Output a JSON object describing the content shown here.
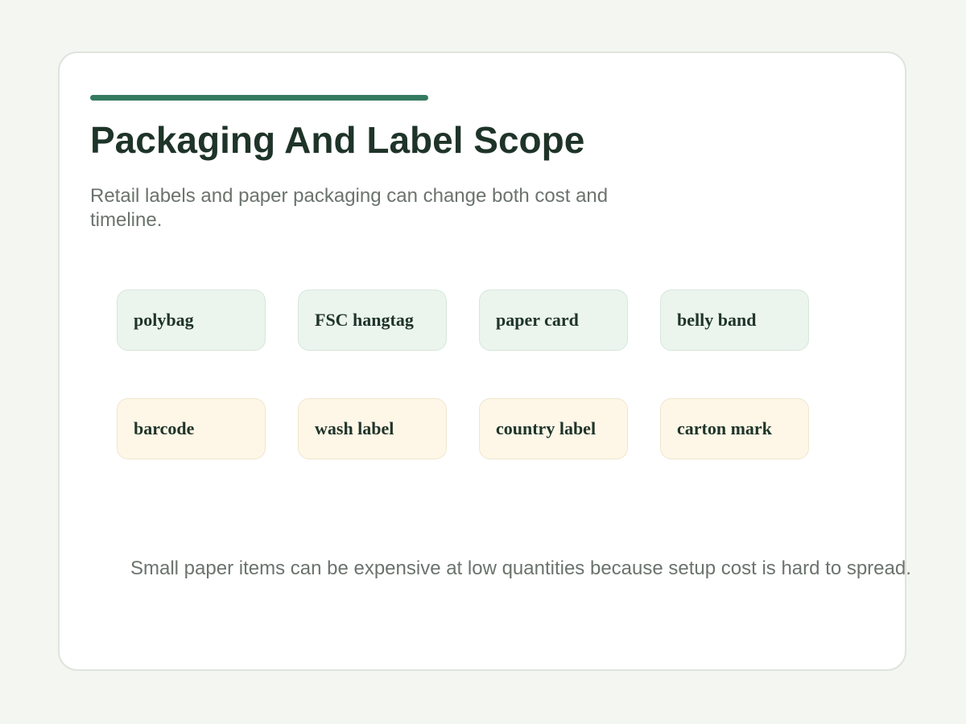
{
  "slide": {
    "title": "Packaging And Label Scope",
    "subtitle": "Retail labels and paper packaging can change both cost and timeline.",
    "note": "Small paper items can be expensive at low quantities because setup cost is hard to spread."
  },
  "chips": {
    "row1": [
      {
        "label": "polybag"
      },
      {
        "label": "FSC hangtag"
      },
      {
        "label": "paper card"
      },
      {
        "label": "belly band"
      }
    ],
    "row2": [
      {
        "label": "barcode"
      },
      {
        "label": "wash label"
      },
      {
        "label": "country label"
      },
      {
        "label": "carton mark"
      }
    ]
  },
  "colors": {
    "accent": "#347a60",
    "title": "#1f3429",
    "muted_text": "#6b736d",
    "row1_fill": "#ebf5ed",
    "row2_fill": "#fef7e7",
    "page_background": "#f4f6f1"
  }
}
